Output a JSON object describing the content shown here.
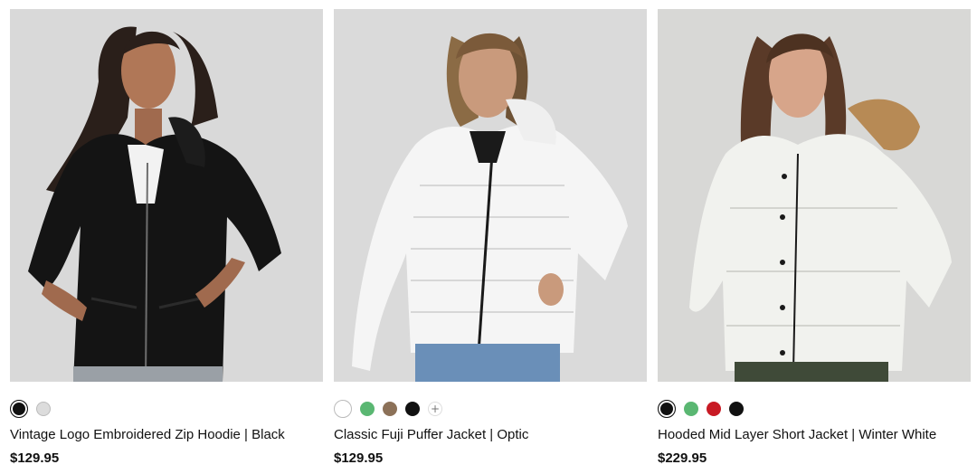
{
  "products": [
    {
      "title": "Vintage Logo Embroidered Zip Hoodie | Black",
      "price": "$129.95",
      "swatches": [
        "#111111",
        "#dcdcdc"
      ],
      "selected": 0,
      "more_icon": "plus-icon",
      "show_more": false,
      "image_bg": "#d9d9d9",
      "garment_color": "#141414"
    },
    {
      "title": "Classic Fuji Puffer Jacket | Optic",
      "price": "$129.95",
      "swatches": [
        "#ffffff",
        "#5ab772",
        "#8c7158",
        "#111111"
      ],
      "selected": 0,
      "show_more": true,
      "more_icon": "plus-icon",
      "image_bg": "#dadada",
      "garment_color": "#f5f5f5"
    },
    {
      "title": "Hooded Mid Layer Short Jacket | Winter White",
      "price": "$229.95",
      "swatches": [
        "#111111",
        "#5ab772",
        "#c81a24",
        "#111111"
      ],
      "selected": 0,
      "show_more": false,
      "more_icon": "plus-icon",
      "image_bg": "#d8d8d6",
      "garment_color": "#f1f2ee"
    }
  ]
}
